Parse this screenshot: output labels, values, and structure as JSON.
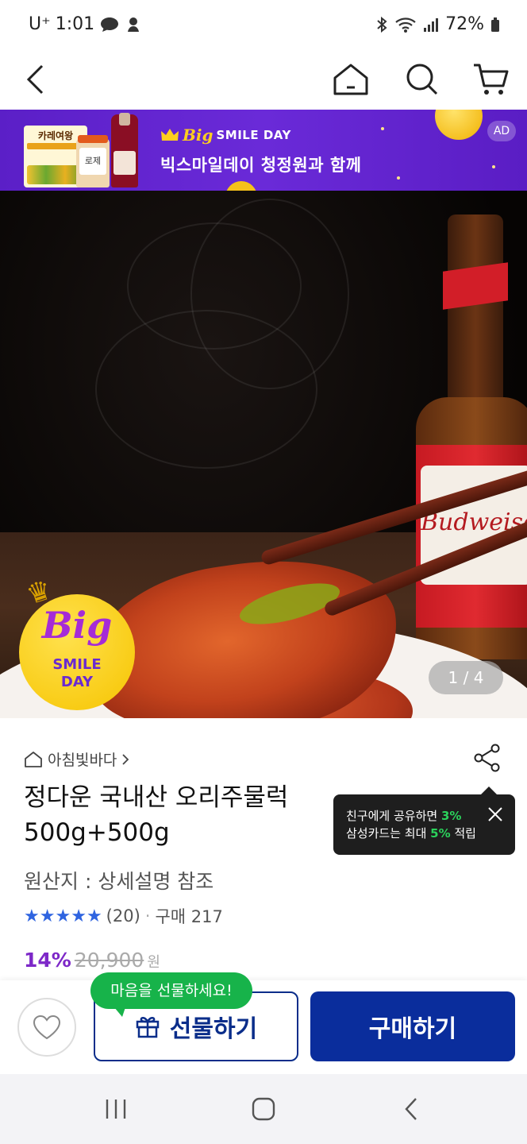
{
  "status_bar": {
    "carrier": "U⁺",
    "time": "1:01",
    "battery": "72%"
  },
  "ad_banner": {
    "brand_big": "Big",
    "brand_rest": "SMILE DAY",
    "headline": "빅스마일데이 청정원과 함께",
    "ad_label": "AD",
    "product1_label": "카레여왕",
    "product2_label": "로제"
  },
  "hero": {
    "badge_big": "Big",
    "badge_line1": "SMILE",
    "badge_line2": "DAY",
    "bottle_text": "Budweiser",
    "counter": "1 / 4"
  },
  "product": {
    "seller": "아침빛바다",
    "title": "정다운 국내산 오리주물럭 500g+500g",
    "origin": "원산지 : 상세설명 참조",
    "rating_stars": 5,
    "review_count": "(20)",
    "separator": "·",
    "purchase_count": "구매 217",
    "discount": "14%",
    "original_price": "20,900",
    "currency": "원"
  },
  "share_tooltip": {
    "line1_prefix": "친구에게 공유하면 ",
    "line1_pct": "3%",
    "line2_prefix": "삼성카드는 최대 ",
    "line2_pct": "5%",
    "line2_suffix": " 적립"
  },
  "action_bar": {
    "gift_bubble": "마음을 선물하세요!",
    "gift_label": "선물하기",
    "buy_label": "구매하기"
  },
  "colors": {
    "brand_blue": "#0a2d9c",
    "discount_purple": "#7d28c8",
    "star_blue": "#2f64e0",
    "bubble_green": "#17b34a",
    "banner_purple": "#5b1fc7"
  }
}
